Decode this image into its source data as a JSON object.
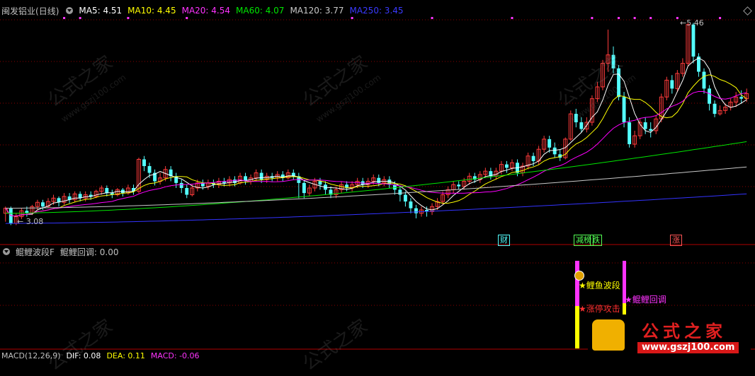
{
  "colors": {
    "up": "#ff3b3b",
    "down": "#54ffff",
    "ma5": "#ffffff",
    "ma10": "#ffff00",
    "ma20": "#ff00ff",
    "ma60": "#00e600",
    "ma120": "#c8c8c8",
    "ma250": "#3333ff",
    "bg": "#000000",
    "grid": "#8b0000",
    "label_gray": "#c0c0c0",
    "magenta": "#ff33ff",
    "yellow": "#ffff00",
    "red": "#ff2020"
  },
  "main_panel": {
    "stock_name": "闽发铝业",
    "period": "(日线)",
    "ma5": "MA5: 4.51",
    "ma10": "MA10: 4.45",
    "ma20": "MA20: 4.54",
    "ma60": "MA60: 4.07",
    "ma120": "MA120: 3.77",
    "ma250": "MA250: 3.45",
    "high_label": "5.46",
    "low_label": "3.08",
    "events": [
      "财",
      "减榜",
      "跌",
      "涨"
    ]
  },
  "sub_panel": {
    "indicator_name": "鲲鲤波段F",
    "indicator_value": "鲲鲤回调: 0.00",
    "signal_1": "鲤鱼波段",
    "signal_2": "涨停攻击",
    "signal_3": "鲲鲤回调"
  },
  "macd_panel": {
    "label": "MACD(12,26,9)",
    "dif": "DIF: 0.08",
    "dea": "DEA: 0.11",
    "macd": "MACD: -0.06"
  },
  "watermark": {
    "text": "公式之家",
    "url": "www.gszj100.com"
  },
  "chart_data": {
    "type": "candlestick",
    "title": "闽发铝业(日线)",
    "y_range": [
      3.0,
      5.55
    ],
    "labels": {
      "high": 5.46,
      "low": 3.08
    },
    "ma_latest": {
      "MA5": 4.51,
      "MA10": 4.45,
      "MA20": 4.54,
      "MA60": 4.07,
      "MA120": 3.77,
      "MA250": 3.45
    },
    "candles": [
      [
        3.22,
        3.28,
        3.12,
        3.3
      ],
      [
        3.28,
        3.1,
        3.08,
        3.3
      ],
      [
        3.1,
        3.18,
        3.08,
        3.22
      ],
      [
        3.18,
        3.25,
        3.15,
        3.28
      ],
      [
        3.25,
        3.22,
        3.18,
        3.3
      ],
      [
        3.22,
        3.3,
        3.2,
        3.32
      ],
      [
        3.3,
        3.35,
        3.26,
        3.38
      ],
      [
        3.35,
        3.3,
        3.26,
        3.38
      ],
      [
        3.3,
        3.36,
        3.28,
        3.4
      ],
      [
        3.36,
        3.4,
        3.32,
        3.44
      ],
      [
        3.4,
        3.35,
        3.3,
        3.42
      ],
      [
        3.35,
        3.42,
        3.32,
        3.46
      ],
      [
        3.42,
        3.38,
        3.34,
        3.46
      ],
      [
        3.38,
        3.45,
        3.35,
        3.48
      ],
      [
        3.45,
        3.4,
        3.36,
        3.48
      ],
      [
        3.4,
        3.44,
        3.36,
        3.48
      ],
      [
        3.44,
        3.42,
        3.38,
        3.48
      ],
      [
        3.42,
        3.48,
        3.4,
        3.5
      ],
      [
        3.48,
        3.52,
        3.44,
        3.55
      ],
      [
        3.52,
        3.46,
        3.42,
        3.55
      ],
      [
        3.46,
        3.44,
        3.4,
        3.5
      ],
      [
        3.44,
        3.5,
        3.42,
        3.52
      ],
      [
        3.5,
        3.46,
        3.42,
        3.52
      ],
      [
        3.46,
        3.52,
        3.44,
        3.56
      ],
      [
        3.52,
        3.48,
        3.44,
        3.56
      ],
      [
        3.48,
        3.86,
        3.46,
        3.88
      ],
      [
        3.86,
        3.78,
        3.72,
        3.9
      ],
      [
        3.78,
        3.7,
        3.64,
        3.82
      ],
      [
        3.7,
        3.6,
        3.55,
        3.74
      ],
      [
        3.6,
        3.64,
        3.56,
        3.7
      ],
      [
        3.64,
        3.74,
        3.6,
        3.78
      ],
      [
        3.74,
        3.66,
        3.6,
        3.78
      ],
      [
        3.66,
        3.58,
        3.52,
        3.7
      ],
      [
        3.58,
        3.52,
        3.46,
        3.62
      ],
      [
        3.52,
        3.44,
        3.4,
        3.56
      ],
      [
        3.44,
        3.52,
        3.42,
        3.56
      ],
      [
        3.52,
        3.58,
        3.48,
        3.62
      ],
      [
        3.58,
        3.54,
        3.5,
        3.62
      ],
      [
        3.54,
        3.58,
        3.5,
        3.62
      ],
      [
        3.58,
        3.56,
        3.52,
        3.62
      ],
      [
        3.56,
        3.6,
        3.52,
        3.64
      ],
      [
        3.6,
        3.58,
        3.54,
        3.64
      ],
      [
        3.58,
        3.62,
        3.54,
        3.66
      ],
      [
        3.62,
        3.58,
        3.54,
        3.66
      ],
      [
        3.58,
        3.66,
        3.56,
        3.7
      ],
      [
        3.66,
        3.6,
        3.56,
        3.7
      ],
      [
        3.6,
        3.64,
        3.56,
        3.68
      ],
      [
        3.64,
        3.7,
        3.6,
        3.74
      ],
      [
        3.7,
        3.62,
        3.58,
        3.74
      ],
      [
        3.62,
        3.66,
        3.58,
        3.7
      ],
      [
        3.66,
        3.64,
        3.6,
        3.7
      ],
      [
        3.64,
        3.68,
        3.6,
        3.72
      ],
      [
        3.68,
        3.64,
        3.6,
        3.72
      ],
      [
        3.64,
        3.7,
        3.62,
        3.74
      ],
      [
        3.7,
        3.66,
        3.62,
        3.74
      ],
      [
        3.66,
        3.58,
        3.4,
        3.7
      ],
      [
        3.58,
        3.46,
        3.4,
        3.62
      ],
      [
        3.46,
        3.52,
        3.42,
        3.56
      ],
      [
        3.52,
        3.6,
        3.48,
        3.64
      ],
      [
        3.6,
        3.56,
        3.5,
        3.64
      ],
      [
        3.56,
        3.5,
        3.44,
        3.6
      ],
      [
        3.5,
        3.44,
        3.4,
        3.54
      ],
      [
        3.44,
        3.5,
        3.4,
        3.54
      ],
      [
        3.5,
        3.56,
        3.46,
        3.6
      ],
      [
        3.56,
        3.52,
        3.48,
        3.6
      ],
      [
        3.52,
        3.56,
        3.48,
        3.6
      ],
      [
        3.56,
        3.6,
        3.52,
        3.64
      ],
      [
        3.6,
        3.56,
        3.52,
        3.64
      ],
      [
        3.56,
        3.6,
        3.52,
        3.64
      ],
      [
        3.6,
        3.64,
        3.56,
        3.68
      ],
      [
        3.64,
        3.58,
        3.54,
        3.68
      ],
      [
        3.58,
        3.62,
        3.54,
        3.66
      ],
      [
        3.62,
        3.56,
        3.52,
        3.66
      ],
      [
        3.56,
        3.5,
        3.44,
        3.6
      ],
      [
        3.5,
        3.44,
        3.36,
        3.54
      ],
      [
        3.44,
        3.36,
        3.3,
        3.48
      ],
      [
        3.36,
        3.28,
        3.22,
        3.4
      ],
      [
        3.28,
        3.22,
        3.16,
        3.32
      ],
      [
        3.22,
        3.26,
        3.18,
        3.3
      ],
      [
        3.26,
        3.24,
        3.18,
        3.3
      ],
      [
        3.24,
        3.3,
        3.2,
        3.34
      ],
      [
        3.3,
        3.36,
        3.26,
        3.4
      ],
      [
        3.36,
        3.44,
        3.32,
        3.48
      ],
      [
        3.44,
        3.5,
        3.4,
        3.54
      ],
      [
        3.5,
        3.56,
        3.46,
        3.6
      ],
      [
        3.56,
        3.54,
        3.5,
        3.6
      ],
      [
        3.54,
        3.6,
        3.5,
        3.64
      ],
      [
        3.6,
        3.66,
        3.56,
        3.7
      ],
      [
        3.66,
        3.62,
        3.58,
        3.7
      ],
      [
        3.62,
        3.68,
        3.58,
        3.72
      ],
      [
        3.68,
        3.72,
        3.64,
        3.76
      ],
      [
        3.72,
        3.66,
        3.62,
        3.76
      ],
      [
        3.66,
        3.72,
        3.62,
        3.76
      ],
      [
        3.72,
        3.8,
        3.68,
        3.84
      ],
      [
        3.8,
        3.76,
        3.7,
        3.84
      ],
      [
        3.76,
        3.82,
        3.72,
        3.86
      ],
      [
        3.82,
        3.7,
        3.66,
        3.86
      ],
      [
        3.7,
        3.78,
        3.66,
        3.82
      ],
      [
        3.78,
        3.9,
        3.74,
        3.94
      ],
      [
        3.9,
        3.84,
        3.78,
        3.94
      ],
      [
        3.84,
        3.98,
        3.8,
        4.02
      ],
      [
        3.98,
        4.1,
        3.94,
        4.14
      ],
      [
        4.1,
        4.0,
        3.94,
        4.14
      ],
      [
        4.0,
        3.92,
        3.88,
        4.06
      ],
      [
        3.92,
        3.88,
        3.84,
        3.98
      ],
      [
        3.88,
        4.1,
        3.86,
        4.12
      ],
      [
        4.1,
        4.4,
        4.08,
        4.44
      ],
      [
        4.4,
        4.3,
        4.24,
        4.46
      ],
      [
        4.3,
        4.22,
        4.18,
        4.36
      ],
      [
        4.22,
        4.3,
        4.18,
        4.36
      ],
      [
        4.3,
        4.58,
        4.26,
        4.62
      ],
      [
        4.58,
        4.72,
        4.54,
        4.78
      ],
      [
        4.72,
        5.0,
        4.68,
        5.04
      ],
      [
        5.0,
        5.1,
        4.9,
        5.4
      ],
      [
        5.1,
        4.94,
        4.88,
        5.2
      ],
      [
        4.94,
        4.6,
        4.56,
        4.98
      ],
      [
        4.6,
        4.3,
        4.24,
        4.66
      ],
      [
        4.3,
        4.04,
        4.0,
        4.36
      ],
      [
        4.04,
        4.14,
        4.0,
        4.2
      ],
      [
        4.14,
        4.3,
        4.1,
        4.34
      ],
      [
        4.3,
        4.22,
        4.16,
        4.36
      ],
      [
        4.22,
        4.2,
        4.12,
        4.3
      ],
      [
        4.2,
        4.34,
        4.16,
        4.38
      ],
      [
        4.34,
        4.6,
        4.3,
        4.64
      ],
      [
        4.6,
        4.8,
        4.56,
        4.84
      ],
      [
        4.8,
        4.7,
        4.64,
        4.86
      ],
      [
        4.7,
        4.88,
        4.66,
        4.92
      ],
      [
        4.88,
        5.0,
        4.84,
        5.06
      ],
      [
        5.0,
        5.46,
        4.96,
        5.48
      ],
      [
        5.46,
        5.08,
        5.0,
        5.48
      ],
      [
        5.08,
        4.9,
        4.84,
        5.12
      ],
      [
        4.9,
        4.7,
        4.64,
        4.94
      ],
      [
        4.7,
        4.52,
        4.44,
        4.74
      ],
      [
        4.52,
        4.4,
        4.36,
        4.56
      ],
      [
        4.4,
        4.44,
        4.38,
        4.5
      ],
      [
        4.44,
        4.48,
        4.4,
        4.52
      ],
      [
        4.48,
        4.54,
        4.44,
        4.58
      ],
      [
        4.54,
        4.6,
        4.48,
        4.66
      ],
      [
        4.6,
        4.58,
        4.52,
        4.68
      ],
      [
        4.58,
        4.64,
        4.54,
        4.7
      ]
    ],
    "series": [
      {
        "name": "MA5",
        "values": []
      },
      {
        "name": "MA10",
        "values": []
      },
      {
        "name": "MA20",
        "values": []
      },
      {
        "name": "MA60",
        "values": []
      },
      {
        "name": "MA120",
        "values": []
      },
      {
        "name": "MA250",
        "values": []
      }
    ]
  }
}
